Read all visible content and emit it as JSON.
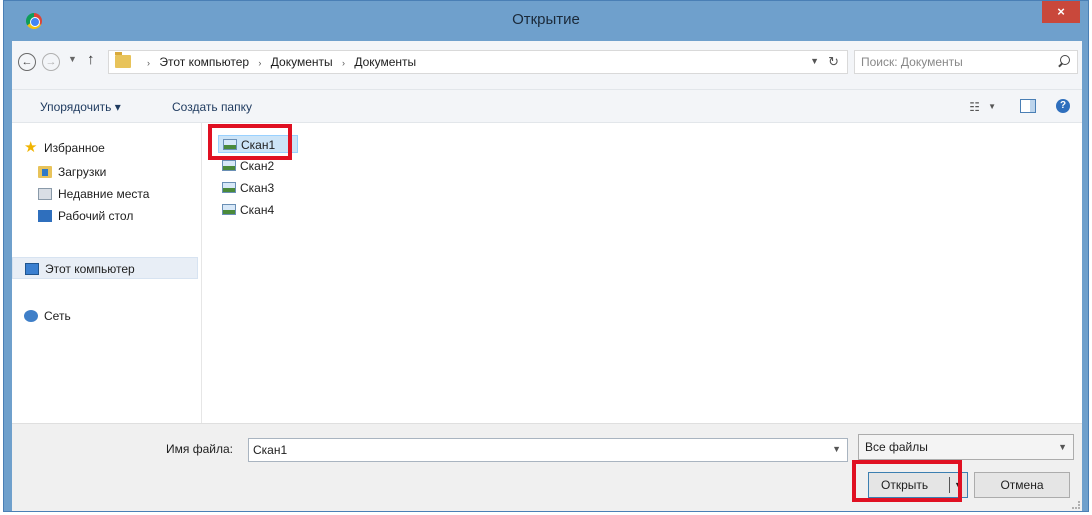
{
  "window": {
    "title": "Открытие",
    "close_label": "×",
    "accent": "#6fa0cc"
  },
  "address": {
    "crumbs": [
      "Этот компьютер",
      "Документы",
      "Документы"
    ],
    "crumb_separator": "›",
    "search_placeholder": "Поиск: Документы"
  },
  "toolbar": {
    "organize_label": "Упорядочить ▾",
    "new_folder_label": "Создать папку"
  },
  "nav": {
    "favorites": "Избранное",
    "downloads": "Загрузки",
    "recent": "Недавние места",
    "desktop": "Рабочий стол",
    "this_pc": "Этот компьютер",
    "network": "Сеть"
  },
  "files": [
    "Скан1",
    "Скан2",
    "Скан3",
    "Скан4"
  ],
  "bottom": {
    "filename_label": "Имя файла:",
    "filename_value": "Скан1",
    "filetype_value": "Все файлы",
    "open_label": "Открыть",
    "cancel_label": "Отмена"
  },
  "highlight_color": "#e01022"
}
